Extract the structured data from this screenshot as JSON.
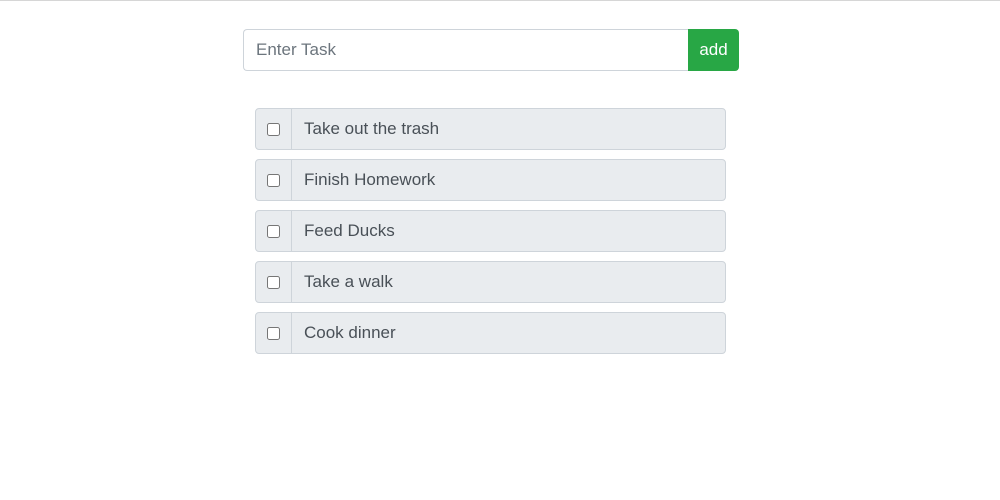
{
  "form": {
    "input_placeholder": "Enter Task",
    "input_value": "",
    "add_label": "add"
  },
  "tasks": [
    {
      "label": "Take out the trash",
      "checked": false
    },
    {
      "label": "Finish Homework",
      "checked": false
    },
    {
      "label": "Feed Ducks",
      "checked": false
    },
    {
      "label": "Take a walk",
      "checked": false
    },
    {
      "label": "Cook dinner",
      "checked": false
    }
  ],
  "colors": {
    "add_button": "#28a745",
    "item_background": "#e9ecef",
    "border": "#ced4da",
    "text": "#495057"
  }
}
